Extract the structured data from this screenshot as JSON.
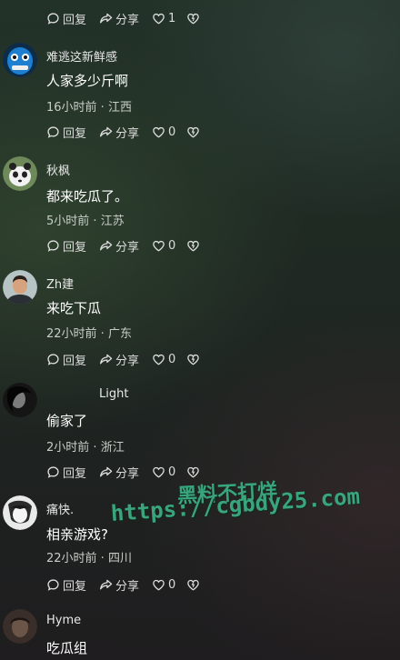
{
  "labels": {
    "reply": "回复",
    "share": "分享"
  },
  "top_actions": {
    "like_count": "1"
  },
  "comments": [
    {
      "username": "难逃这新鲜感",
      "text": "人家多少斤啊",
      "time": "16小时前",
      "location": "江西",
      "like_count": "0"
    },
    {
      "username": "秋枫",
      "text": "都来吃瓜了。",
      "time": "5小时前",
      "location": "江苏",
      "like_count": "0"
    },
    {
      "username": "Zh建",
      "text": "来吃下瓜",
      "time": "22小时前",
      "location": "广东",
      "like_count": "0"
    },
    {
      "username": "Light",
      "text": "偷家了",
      "time": "2小时前",
      "location": "浙江",
      "like_count": "0"
    },
    {
      "username": "痛快.",
      "text": "相亲游戏?",
      "time": "22小时前",
      "location": "四川",
      "like_count": "0"
    },
    {
      "username": "Hyme",
      "text": "吃瓜组"
    }
  ],
  "watermark": {
    "line1": "黑料不打烊",
    "line2": "https://cgbdy25.com"
  },
  "colors": {
    "background": "#1f2a23",
    "watermark": "#3aa57d"
  }
}
